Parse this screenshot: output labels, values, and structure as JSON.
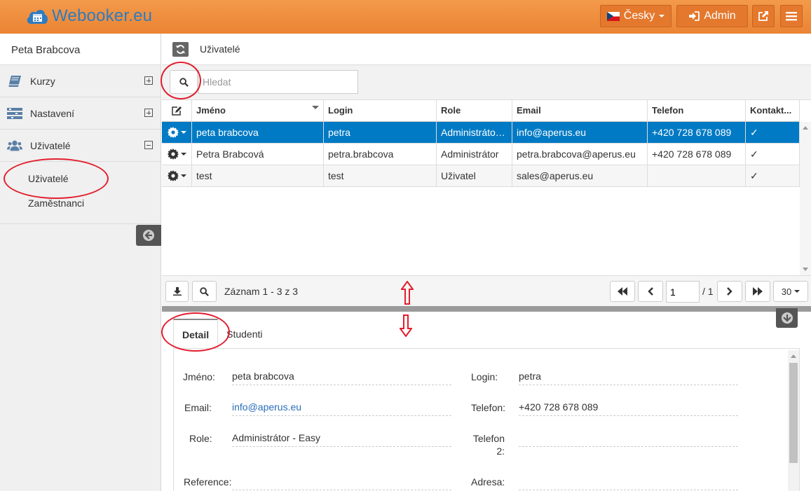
{
  "header": {
    "app_name": "Webooker.eu",
    "language_label": "Česky",
    "admin_label": "Admin",
    "colors": {
      "header_bg": "#f08a3c",
      "logo": "#2f7bc1"
    }
  },
  "sidebar": {
    "user_name": "Peta Brabcova",
    "items": [
      {
        "label": "Kurzy",
        "icon": "book-icon"
      },
      {
        "label": "Nastavení",
        "icon": "settings-bars-icon"
      },
      {
        "label": "Uživatelé",
        "icon": "users-icon"
      }
    ],
    "submenu": [
      "Uživatelé",
      "Zaměstnanci"
    ]
  },
  "main": {
    "title": "Uživatelé",
    "search_placeholder": "Hledat"
  },
  "grid": {
    "columns": [
      "Jméno",
      "Login",
      "Role",
      "Email",
      "Telefon",
      "Kontakt..."
    ],
    "rows": [
      {
        "name": "peta brabcova",
        "login": "petra",
        "role": "Administráto…",
        "email": "info@aperus.eu",
        "phone": "+420 728 678 089",
        "contact": "✓"
      },
      {
        "name": "Petra Brabcová",
        "login": "petra.brabcova",
        "role": "Administrátor",
        "email": "petra.brabcova@aperus.eu",
        "phone": "+420 728 678 089",
        "contact": "✓"
      },
      {
        "name": "test",
        "login": "test",
        "role": "Uživatel",
        "email": "sales@aperus.eu",
        "phone": "",
        "contact": "✓"
      }
    ],
    "selected_color": "#007ac4"
  },
  "pager": {
    "record_info": "Záznam 1 - 3 z 3",
    "page": "1",
    "total": "/ 1",
    "page_size": "30"
  },
  "detail": {
    "tabs": [
      "Detail",
      "Studenti"
    ],
    "fields": {
      "name_label": "Jméno:",
      "name_value": "peta brabcova",
      "login_label": "Login:",
      "login_value": "petra",
      "email_label": "Email:",
      "email_value": "info@aperus.eu",
      "phone_label": "Telefon:",
      "phone_value": "+420 728 678 089",
      "role_label": "Role:",
      "role_value": "Administrátor - Easy",
      "phone2_label_1": "Telefon",
      "phone2_label_2": "2:",
      "phone2_value": "",
      "reference_label": "Reference:",
      "reference_value": "",
      "address_label": "Adresa:",
      "address_value": ""
    }
  }
}
